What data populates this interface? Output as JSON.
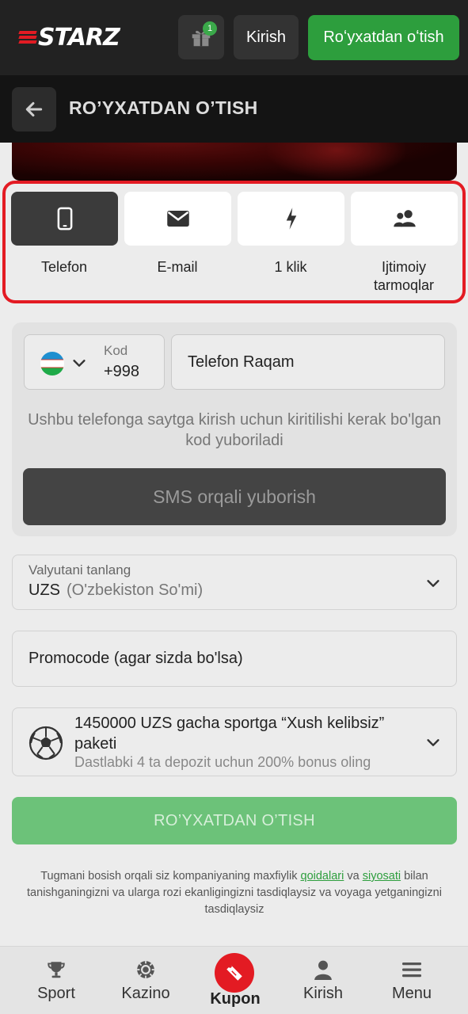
{
  "header": {
    "logo_text": "STARZ",
    "gift_badge_count": "1",
    "login_label": "Kirish",
    "register_label": "Roʻyxatdan oʻtish"
  },
  "subheader": {
    "title": "RO’YXATDAN O’TISH"
  },
  "methods": {
    "selected": "Telefon",
    "items": [
      {
        "label": "Telefon",
        "icon": "smartphone-icon"
      },
      {
        "label": "E-mail",
        "icon": "envelope-icon"
      },
      {
        "label": "1 klik",
        "icon": "lightning-icon"
      },
      {
        "label": "Ijtimoiy tarmoqlar",
        "icon": "users-icon"
      }
    ]
  },
  "phone_form": {
    "country_flag": "uzbekistan-flag",
    "code_label": "Kod",
    "code_value": "+998",
    "phone_placeholder": "Telefon Raqam",
    "hint": "Ushbu telefonga saytga kirish uchun kiritilishi kerak bo'lgan kod yuboriladi",
    "sms_button": "SMS orqali yuborish"
  },
  "currency": {
    "label": "Valyutani tanlang",
    "code": "UZS",
    "name": "(O'zbekiston So'mi)"
  },
  "promo": {
    "placeholder": "Promocode (agar sizda bo'lsa)"
  },
  "bonus": {
    "title": "1450000 UZS gacha sportga “Xush kelibsiz” paketi",
    "subtitle": "Dastlabki 4 ta depozit uchun 200% bonus oling"
  },
  "submit_label": "RO’YXATDAN O’TISH",
  "terms": {
    "part1": "Tugmani bosish orqali siz kompaniyaning maxfiylik ",
    "link1": "qoidalari",
    "part2": " va ",
    "link2": "siyosati",
    "part3": " bilan tanishganingizni va ularga rozi ekanligingizni tasdiqlaysiz va voyaga yetganingizni tasdiqlaysiz"
  },
  "bottom_nav": [
    {
      "label": "Sport",
      "icon": "trophy-icon"
    },
    {
      "label": "Kazino",
      "icon": "casino-chip-icon"
    },
    {
      "label": "Kupon",
      "icon": "ticket-icon"
    },
    {
      "label": "Kirish",
      "icon": "user-icon"
    },
    {
      "label": "Menu",
      "icon": "hamburger-icon"
    }
  ],
  "colors": {
    "brand_red": "#e31b23",
    "brand_green": "#2d9e3d",
    "header_bg": "#222222"
  }
}
